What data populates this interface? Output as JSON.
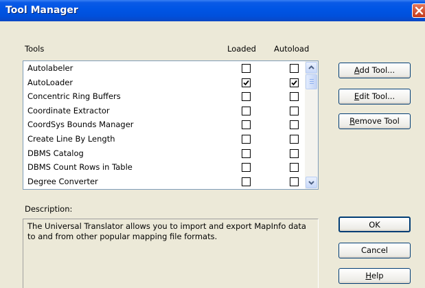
{
  "window": {
    "title": "Tool Manager"
  },
  "columns": {
    "tools": "Tools",
    "loaded": "Loaded",
    "autoload": "Autoload"
  },
  "tools": [
    {
      "name": "Autolabeler",
      "loaded": false,
      "autoload": false
    },
    {
      "name": "AutoLoader",
      "loaded": true,
      "autoload": true
    },
    {
      "name": "Concentric Ring Buffers",
      "loaded": false,
      "autoload": false
    },
    {
      "name": "Coordinate Extractor",
      "loaded": false,
      "autoload": false
    },
    {
      "name": "CoordSys Bounds Manager",
      "loaded": false,
      "autoload": false
    },
    {
      "name": "Create Line By Length",
      "loaded": false,
      "autoload": false
    },
    {
      "name": "DBMS Catalog",
      "loaded": false,
      "autoload": false
    },
    {
      "name": "DBMS Count Rows in Table",
      "loaded": false,
      "autoload": false
    },
    {
      "name": "Degree Converter",
      "loaded": false,
      "autoload": false
    }
  ],
  "buttons": {
    "add_tool": {
      "mnemonic": "A",
      "rest": "dd Tool..."
    },
    "edit_tool": {
      "mnemonic": "E",
      "rest": "dit Tool..."
    },
    "remove_tool": {
      "mnemonic": "R",
      "rest": "emove Tool"
    },
    "ok": "OK",
    "cancel": "Cancel",
    "help": {
      "mnemonic": "H",
      "rest": "elp"
    }
  },
  "description": {
    "label": "Description:",
    "text": "The Universal Translator allows you to import and export MapInfo data to and from other popular mapping file formats."
  },
  "icons": [
    "close-icon",
    "scroll-up-icon",
    "scroll-down-icon",
    "check-icon"
  ]
}
